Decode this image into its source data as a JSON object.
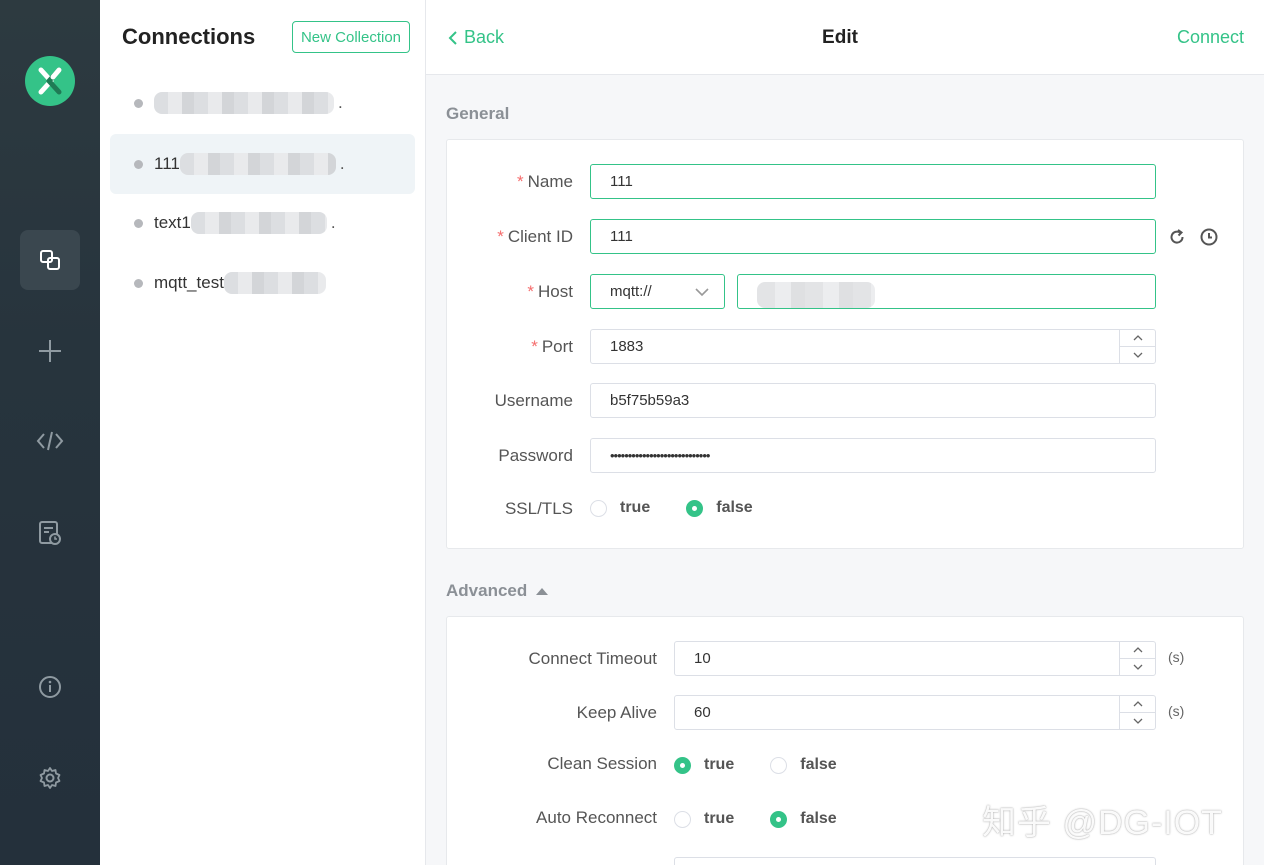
{
  "rail": {
    "icons": [
      "mqttx-logo-icon",
      "connections-icon",
      "plus-icon",
      "script-icon",
      "log-icon",
      "about-icon",
      "settings-icon"
    ]
  },
  "connections": {
    "title": "Connections",
    "new_collection_label": "New Collection",
    "items": [
      {
        "name": "",
        "trail": "."
      },
      {
        "name": "111",
        "trail": "."
      },
      {
        "name": "text1",
        "trail": "."
      },
      {
        "name": "mqtt_test",
        "trail": ""
      }
    ]
  },
  "header": {
    "back_label": "Back",
    "title": "Edit",
    "connect_label": "Connect"
  },
  "general": {
    "title": "General",
    "name_label": "Name",
    "name_value": "111",
    "client_id_label": "Client ID",
    "client_id_value": "111",
    "host_label": "Host",
    "protocol_value": "mqtt://",
    "port_label": "Port",
    "port_value": "1883",
    "username_label": "Username",
    "username_value": "b5f75b59a3",
    "password_label": "Password",
    "password_value": "••••••••••••••••••••••••••••",
    "ssl_label": "SSL/TLS",
    "ssl_true": "true",
    "ssl_false": "false",
    "ssl_selected": "false"
  },
  "advanced": {
    "title": "Advanced",
    "timeout_label": "Connect Timeout",
    "timeout_value": "10",
    "timeout_unit": "(s)",
    "keepalive_label": "Keep Alive",
    "keepalive_value": "60",
    "keepalive_unit": "(s)",
    "clean_label": "Clean Session",
    "clean_true": "true",
    "clean_false": "false",
    "clean_selected": "true",
    "reconnect_label": "Auto Reconnect",
    "reconnect_true": "true",
    "reconnect_false": "false",
    "reconnect_selected": "false"
  },
  "watermark": "知乎 @DG-IOT",
  "colors": {
    "accent": "#34c388",
    "rail_bg": "#2a363e",
    "required": "#f56c6c"
  }
}
